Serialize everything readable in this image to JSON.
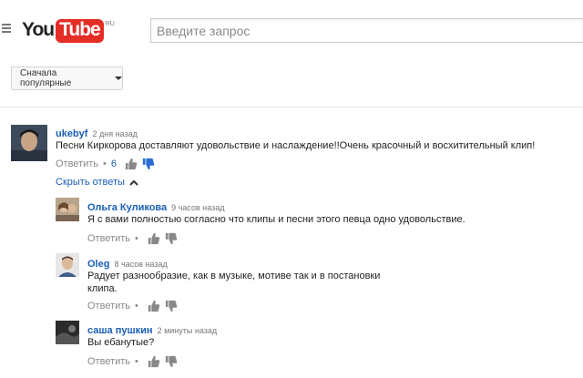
{
  "header": {
    "logo_you": "You",
    "logo_tube": "Tube",
    "logo_region": "RU",
    "search_placeholder": "Введите запрос"
  },
  "sort": {
    "label": "Сначала популярные"
  },
  "main_comment": {
    "author": "ukebyf",
    "time": "2 дня назад",
    "text": "Песни  Киркорова доставляют удовольствие и наслаждение!!Очень красочный и восхитительный клип!",
    "reply_label": "Ответить",
    "likes": "6"
  },
  "hide_replies_label": "Скрыть ответы",
  "replies": [
    {
      "author": "Ольга Куликова",
      "time": "9 часов назад",
      "text": "Я с вами полностью согласно что клипы и песни этого певца одно удовольствие.",
      "reply_label": "Ответить"
    },
    {
      "author": "Oleg",
      "time": "8 часов назад",
      "text_line1": "Радует разнообразие, как в музыке, мотиве так и в постановки",
      "text_line2": "клипа.",
      "reply_label": "Ответить"
    },
    {
      "author": "саша пушкин",
      "time": "2 минуты назад",
      "text": "Вы ебанутые?",
      "reply_label": "Ответить"
    }
  ],
  "colors": {
    "link_blue": "#1a5fb4",
    "liked_blue": "#2a6bd6",
    "brand_red": "#e52d27"
  },
  "icons": [
    "menu-icon",
    "thumb-up-icon",
    "thumb-down-icon",
    "chevron-up-icon"
  ]
}
